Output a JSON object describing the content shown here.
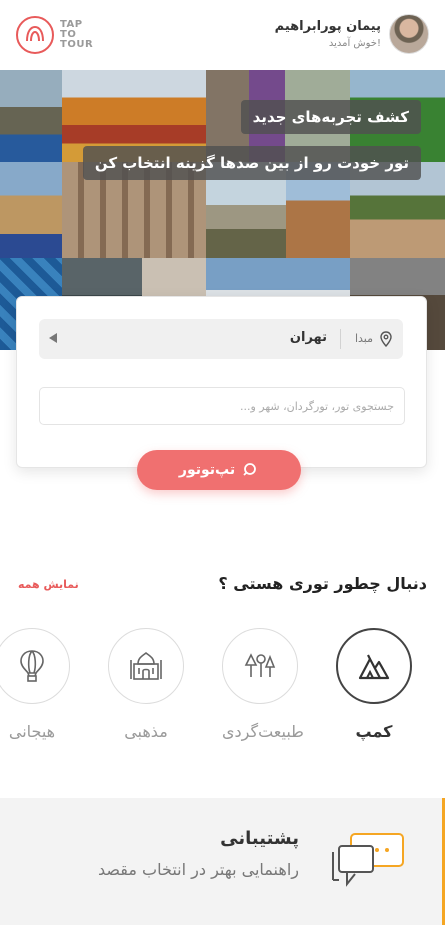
{
  "header": {
    "logo_lines": [
      "TAP",
      "TO",
      "TOUR"
    ],
    "user_name": "پیمان پورابراهیم",
    "welcome": "خوش آمدید!"
  },
  "hero": {
    "headline": "کشف تجربه‌های جدید",
    "subline": "تور خودت رو از بین صدها گزینه انتخاب کن"
  },
  "search": {
    "origin_label": "مبدا",
    "origin_value": "تهران",
    "placeholder": "جستجوی تور، تورگردان، شهر و...",
    "value": "",
    "button_label": "تپ‌توتور"
  },
  "categories_section": {
    "title": "دنبال چطور توری هستی ؟",
    "show_all": "نمایش همه",
    "items": [
      {
        "label": "کمپ",
        "icon": "tent-icon",
        "active": true
      },
      {
        "label": "طبیعت‌گردی",
        "icon": "trees-icon",
        "active": false
      },
      {
        "label": "مذهبی",
        "icon": "mosque-icon",
        "active": false
      },
      {
        "label": "هیجانی",
        "icon": "hot-air-balloon-icon",
        "active": false
      }
    ]
  },
  "support": {
    "title": "پشتیبانی",
    "subtitle": "راهنمایی بهتر در انتخاب مقصد"
  },
  "colors": {
    "brand": "#e85a5a",
    "cta": "#f07070",
    "accent": "#f5a623"
  }
}
